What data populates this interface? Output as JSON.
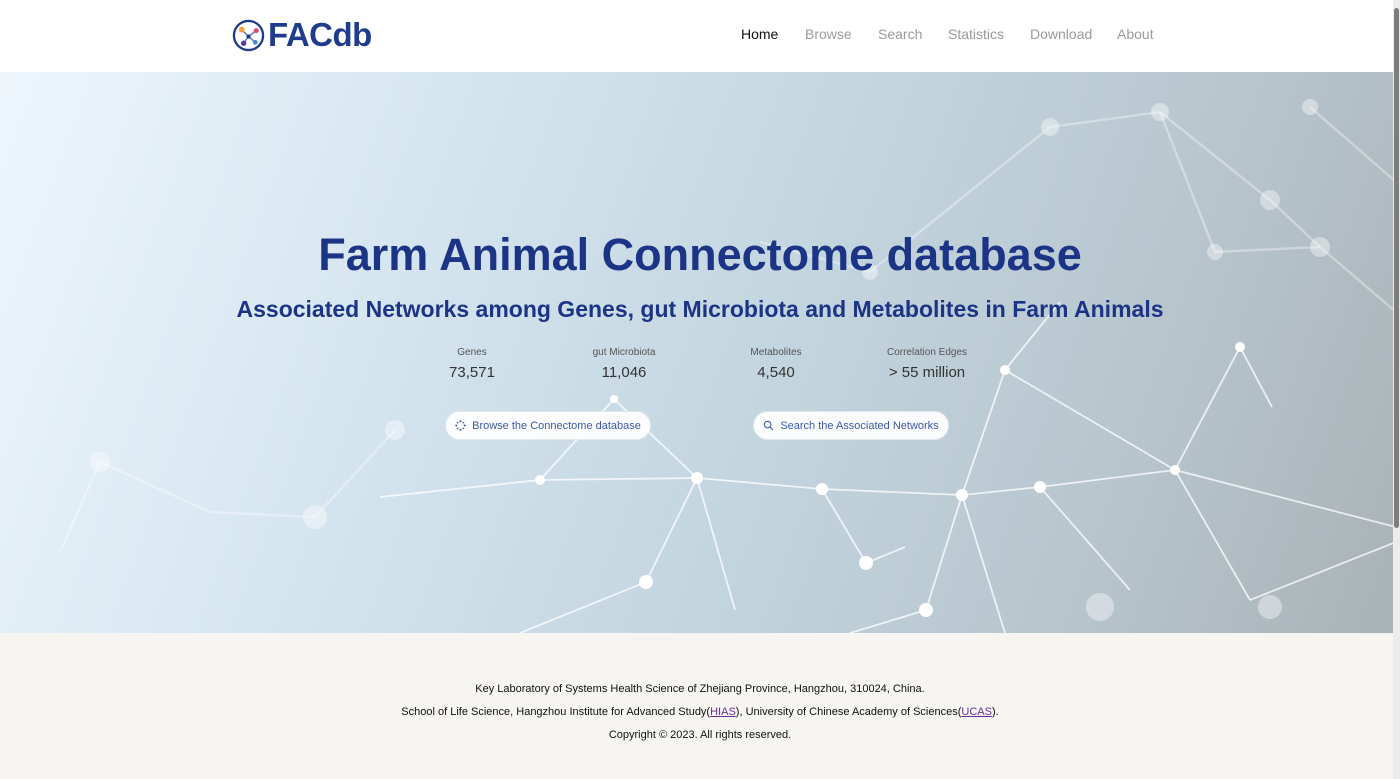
{
  "header": {
    "logo_text": "FACdb",
    "nav": [
      {
        "label": "Home",
        "active": true
      },
      {
        "label": "Browse",
        "active": false
      },
      {
        "label": "Search",
        "active": false
      },
      {
        "label": "Statistics",
        "active": false
      },
      {
        "label": "Download",
        "active": false
      },
      {
        "label": "About",
        "active": false
      }
    ]
  },
  "hero": {
    "title": "Farm Animal Connectome database",
    "subtitle": "Associated Networks among Genes, gut Microbiota and Metabolites in Farm Animals",
    "stats": [
      {
        "label": "Genes",
        "value": "73,571"
      },
      {
        "label": "gut Microbiota",
        "value": "11,046"
      },
      {
        "label": "Metabolites",
        "value": "4,540"
      },
      {
        "label": "Correlation Edges",
        "value": "> 55 million"
      }
    ],
    "buttons": {
      "browse": "Browse the Connectome database",
      "search": "Search the Associated Networks"
    }
  },
  "footer": {
    "line1": "Key Laboratory of Systems Health Science of Zhejiang Province, Hangzhou, 310024, China.",
    "line2_a": "School of Life Science, Hangzhou Institute for Advanced Study(",
    "line2_link1": "HIAS",
    "line2_b": "), University of Chinese Academy of Sciences(",
    "line2_link2": "UCAS",
    "line2_c": ").",
    "copyright": "Copyright © 2023. All rights reserved."
  },
  "colors": {
    "brand": "#1f3c8c",
    "nav_active": "#111111",
    "nav_inactive": "#9a9a9a",
    "link": "#6b2d9c"
  }
}
